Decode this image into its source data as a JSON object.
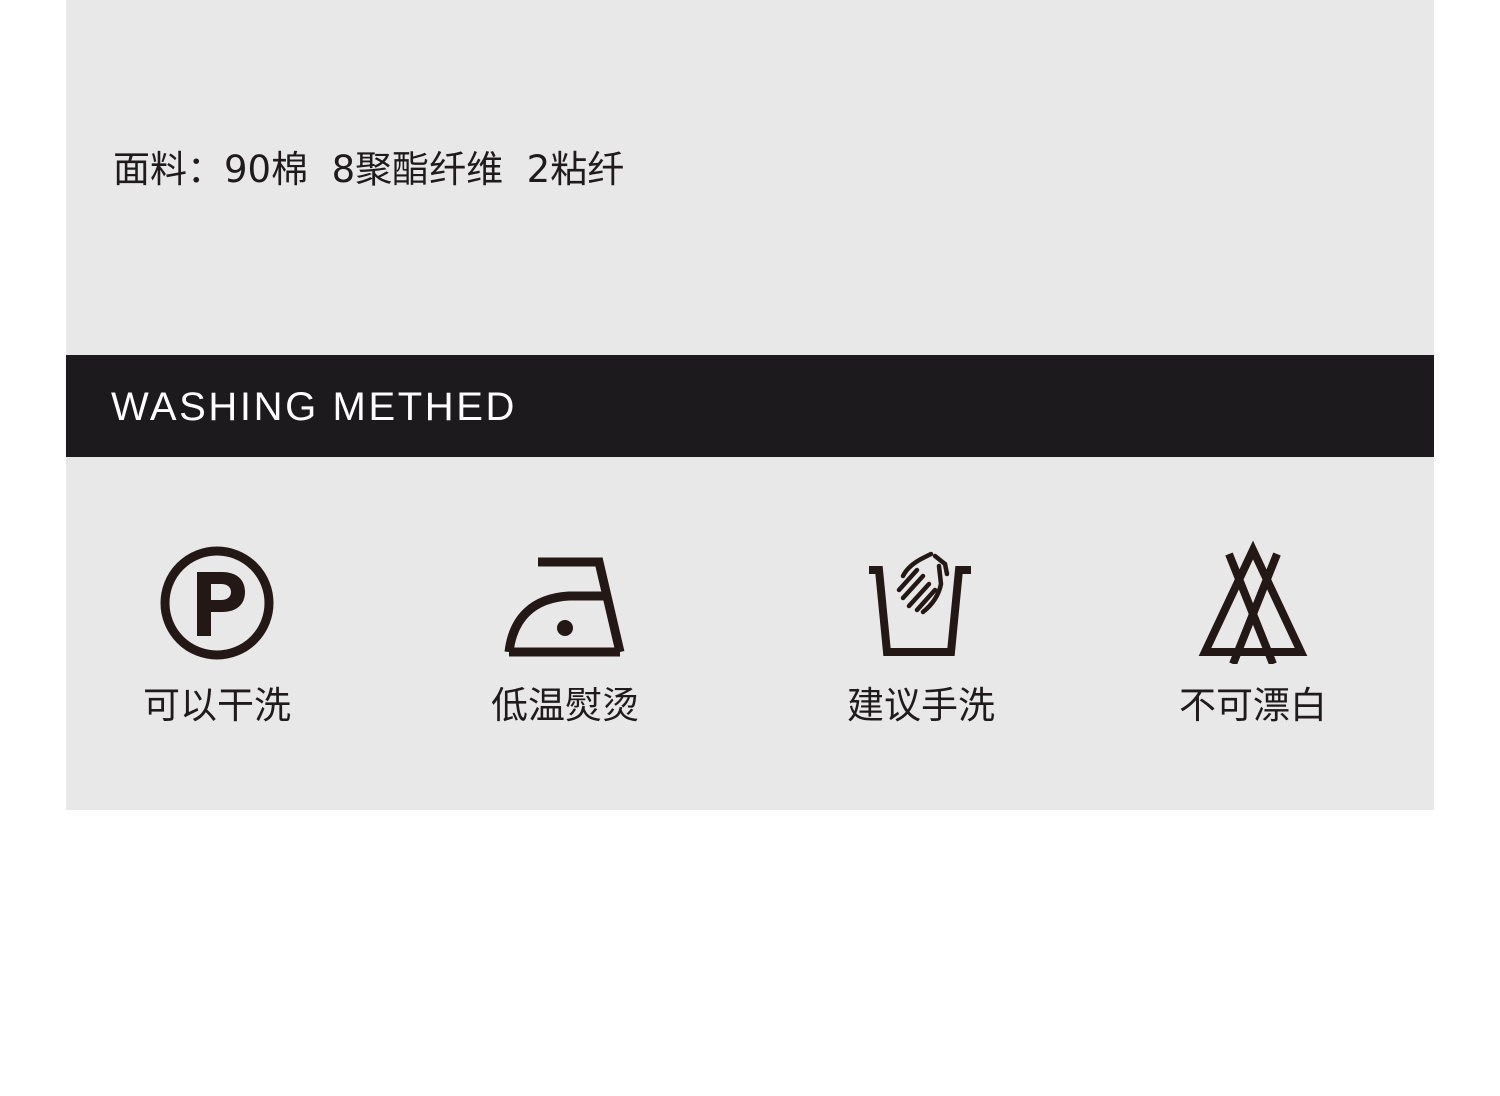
{
  "fabric": {
    "text": "面料：90棉  8聚酯纤维  2粘纤"
  },
  "header": {
    "title": "WASHING METHED"
  },
  "care_items": [
    {
      "label": "可以干洗",
      "icon": "dry-clean-p-icon"
    },
    {
      "label": "低温熨烫",
      "icon": "iron-low-temp-icon"
    },
    {
      "label": "建议手洗",
      "icon": "hand-wash-icon"
    },
    {
      "label": "不可漂白",
      "icon": "no-bleach-icon"
    }
  ],
  "colors": {
    "panel_bg": "#e8e8e8",
    "header_bg": "#1c1a1c",
    "header_text": "#ffffff",
    "text": "#1f1a1b",
    "icon": "#231815"
  }
}
